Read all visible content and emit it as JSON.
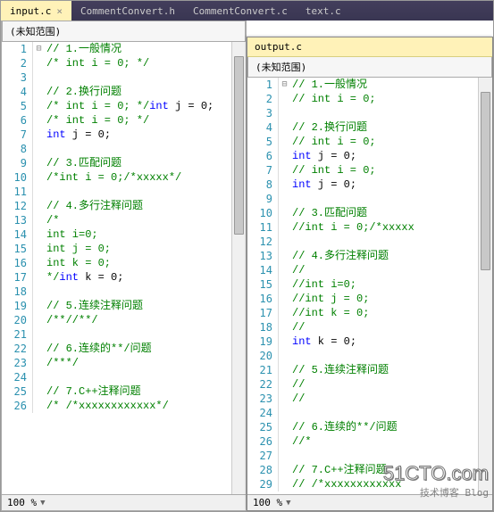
{
  "tabs": [
    {
      "label": "input.c",
      "active": true
    },
    {
      "label": "CommentConvert.h",
      "active": false
    },
    {
      "label": "CommentConvert.c",
      "active": false
    },
    {
      "label": "text.c",
      "active": false
    }
  ],
  "leftPane": {
    "tabLabel": "",
    "scope": "(未知范围)",
    "zoom": "100 %",
    "lines": [
      {
        "n": 1,
        "fold": "⊟",
        "tokens": [
          {
            "t": "// 1.一般情况",
            "c": "comment"
          }
        ]
      },
      {
        "n": 2,
        "tokens": [
          {
            "t": "/* int i = 0; */",
            "c": "comment"
          }
        ]
      },
      {
        "n": 3,
        "tokens": []
      },
      {
        "n": 4,
        "tokens": [
          {
            "t": "// 2.换行问题",
            "c": "comment"
          }
        ]
      },
      {
        "n": 5,
        "tokens": [
          {
            "t": "/* int i = 0; */",
            "c": "comment"
          },
          {
            "t": "int",
            "c": "keyword"
          },
          {
            "t": " j = 0;",
            "c": "plain"
          }
        ]
      },
      {
        "n": 6,
        "tokens": [
          {
            "t": "/* int i = 0; */",
            "c": "comment"
          }
        ]
      },
      {
        "n": 7,
        "tokens": [
          {
            "t": "int",
            "c": "keyword"
          },
          {
            "t": " j = 0;",
            "c": "plain"
          }
        ]
      },
      {
        "n": 8,
        "tokens": []
      },
      {
        "n": 9,
        "tokens": [
          {
            "t": "// 3.匹配问题",
            "c": "comment"
          }
        ]
      },
      {
        "n": 10,
        "tokens": [
          {
            "t": "/*int i = 0;/*xxxxx*/",
            "c": "comment"
          }
        ]
      },
      {
        "n": 11,
        "tokens": []
      },
      {
        "n": 12,
        "tokens": [
          {
            "t": "// 4.多行注释问题",
            "c": "comment"
          }
        ]
      },
      {
        "n": 13,
        "tokens": [
          {
            "t": "/*",
            "c": "comment"
          }
        ]
      },
      {
        "n": 14,
        "tokens": [
          {
            "t": "int i=0;",
            "c": "comment"
          }
        ]
      },
      {
        "n": 15,
        "tokens": [
          {
            "t": "int j = 0;",
            "c": "comment"
          }
        ]
      },
      {
        "n": 16,
        "tokens": [
          {
            "t": "int k = 0;",
            "c": "comment"
          }
        ]
      },
      {
        "n": 17,
        "tokens": [
          {
            "t": "*/",
            "c": "comment"
          },
          {
            "t": "int",
            "c": "keyword"
          },
          {
            "t": " k = 0;",
            "c": "plain"
          }
        ]
      },
      {
        "n": 18,
        "tokens": []
      },
      {
        "n": 19,
        "tokens": [
          {
            "t": "// 5.连续注释问题",
            "c": "comment"
          }
        ]
      },
      {
        "n": 20,
        "tokens": [
          {
            "t": "/**//**/",
            "c": "comment"
          }
        ]
      },
      {
        "n": 21,
        "tokens": []
      },
      {
        "n": 22,
        "tokens": [
          {
            "t": "// 6.连续的**/问题",
            "c": "comment"
          }
        ]
      },
      {
        "n": 23,
        "tokens": [
          {
            "t": "/***/",
            "c": "comment"
          }
        ]
      },
      {
        "n": 24,
        "tokens": []
      },
      {
        "n": 25,
        "tokens": [
          {
            "t": "// 7.C++注释问题",
            "c": "comment"
          }
        ]
      },
      {
        "n": 26,
        "tokens": [
          {
            "t": "/* /*xxxxxxxxxxxx*/",
            "c": "comment"
          }
        ]
      }
    ]
  },
  "rightPane": {
    "tabLabel": "output.c",
    "scope": "(未知范围)",
    "zoom": "100 %",
    "lines": [
      {
        "n": 1,
        "fold": "⊟",
        "tokens": [
          {
            "t": "// 1.一般情况",
            "c": "comment"
          }
        ]
      },
      {
        "n": 2,
        "tokens": [
          {
            "t": "// int i = 0; ",
            "c": "comment"
          }
        ]
      },
      {
        "n": 3,
        "tokens": []
      },
      {
        "n": 4,
        "tokens": [
          {
            "t": "// 2.换行问题",
            "c": "comment"
          }
        ]
      },
      {
        "n": 5,
        "tokens": [
          {
            "t": "// int i = 0; ",
            "c": "comment"
          }
        ]
      },
      {
        "n": 6,
        "tokens": [
          {
            "t": "int",
            "c": "keyword"
          },
          {
            "t": " j = 0;",
            "c": "plain"
          }
        ]
      },
      {
        "n": 7,
        "tokens": [
          {
            "t": "// int i = 0; ",
            "c": "comment"
          }
        ]
      },
      {
        "n": 8,
        "tokens": [
          {
            "t": "int",
            "c": "keyword"
          },
          {
            "t": " j = 0;",
            "c": "plain"
          }
        ]
      },
      {
        "n": 9,
        "tokens": []
      },
      {
        "n": 10,
        "tokens": [
          {
            "t": "// 3.匹配问题",
            "c": "comment"
          }
        ]
      },
      {
        "n": 11,
        "tokens": [
          {
            "t": "//int i = 0;/*xxxxx",
            "c": "comment"
          }
        ]
      },
      {
        "n": 12,
        "tokens": []
      },
      {
        "n": 13,
        "tokens": [
          {
            "t": "// 4.多行注释问题",
            "c": "comment"
          }
        ]
      },
      {
        "n": 14,
        "tokens": [
          {
            "t": "//",
            "c": "comment"
          }
        ]
      },
      {
        "n": 15,
        "tokens": [
          {
            "t": "//int i=0;",
            "c": "comment"
          }
        ]
      },
      {
        "n": 16,
        "tokens": [
          {
            "t": "//int j = 0;",
            "c": "comment"
          }
        ]
      },
      {
        "n": 17,
        "tokens": [
          {
            "t": "//int k = 0;",
            "c": "comment"
          }
        ]
      },
      {
        "n": 18,
        "tokens": [
          {
            "t": "//",
            "c": "comment"
          }
        ]
      },
      {
        "n": 19,
        "tokens": [
          {
            "t": "int",
            "c": "keyword"
          },
          {
            "t": " k = 0;",
            "c": "plain"
          }
        ]
      },
      {
        "n": 20,
        "tokens": []
      },
      {
        "n": 21,
        "tokens": [
          {
            "t": "// 5.连续注释问题",
            "c": "comment"
          }
        ]
      },
      {
        "n": 22,
        "tokens": [
          {
            "t": "//",
            "c": "comment"
          }
        ]
      },
      {
        "n": 23,
        "tokens": [
          {
            "t": "//",
            "c": "comment"
          }
        ]
      },
      {
        "n": 24,
        "tokens": []
      },
      {
        "n": 25,
        "tokens": [
          {
            "t": "// 6.连续的**/问题",
            "c": "comment"
          }
        ]
      },
      {
        "n": 26,
        "tokens": [
          {
            "t": "//*",
            "c": "comment"
          }
        ]
      },
      {
        "n": 27,
        "tokens": []
      },
      {
        "n": 28,
        "tokens": [
          {
            "t": "// 7.C++注释问题",
            "c": "comment"
          }
        ]
      },
      {
        "n": 29,
        "tokens": [
          {
            "t": "// /*xxxxxxxxxxxx",
            "c": "comment"
          }
        ]
      }
    ]
  },
  "watermark": {
    "line1": "51CTO.com",
    "line2": "技术博客   Blog"
  }
}
